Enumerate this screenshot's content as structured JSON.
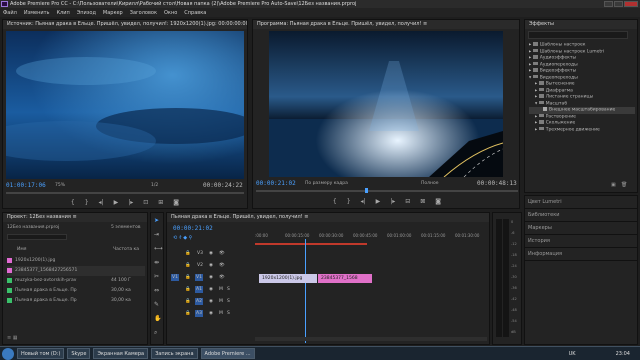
{
  "window": {
    "title": "Adobe Premiere Pro CC - C:\\Пользователи\\Кирилл\\Рабочий стол\\Новая папка (2)\\Adobe Premiere Pro Auto-Save\\12Без названия.prproj"
  },
  "menu": [
    "Файл",
    "Изменить",
    "Клип",
    "Эпизод",
    "Маркер",
    "Заголовок",
    "Окно",
    "Справка"
  ],
  "source": {
    "title": "Источник: Пьяная драка в Ельце. Пришёл, увидел, получил!: 1920x1200(1).jpg: 00:00:00:00",
    "timecode": "01:00:17:06",
    "zoom": "75%",
    "page": "1/2",
    "duration": "00:00:24:22"
  },
  "program": {
    "title": "Программа: Пьяная драка в Ельце. Пришёл, увидел, получил! ≡",
    "timecode": "00:00:21:02",
    "fit": "По размеру кадра",
    "quality": "Полное",
    "duration": "00:00:48:13"
  },
  "effects": {
    "title": "Эффекты",
    "items": [
      "Шаблоны настроек",
      "Шаблоны настроек Lumetri",
      "Аудиоэффекты",
      "Аудиопереходы",
      "Видеоэффекты",
      "Видеопереходы",
      "Вытеснение",
      "Диафрагма",
      "Листание страницы",
      "Масштаб",
      "Внешнее масштабирование",
      "Растворение",
      "Скольжение",
      "Трехмерное движение"
    ],
    "side": [
      "Цвет Lumetri",
      "Библиотеки",
      "Маркеры",
      "История",
      "Информация"
    ]
  },
  "project": {
    "title": "Проект: 12Без названия ≡",
    "file": "12Без названия.prproj",
    "count": "5 элементов",
    "col_name": "Имя",
    "col_rate": "Частота ка",
    "items": [
      {
        "name": "1920x1200(1).jpg",
        "rate": "",
        "color": "#e06ad2"
      },
      {
        "name": "23845377_1568427256571",
        "rate": "",
        "color": "#e06ad2"
      },
      {
        "name": "muzyka-bez-avtorskih-prav",
        "rate": "44 100 Г",
        "color": "#3ac06a"
      },
      {
        "name": "Пьяная драка в Ельце. Пр",
        "rate": "30,00 ка",
        "color": "#3ac06a"
      },
      {
        "name": "Пьяная драка в Ельце. Пр",
        "rate": "30,00 ка",
        "color": "#3ac06a"
      }
    ]
  },
  "timeline": {
    "title": "Пьяная драка в Ельце. Пришёл, увидел, получил! ≡",
    "timecode": "00:00:21:02",
    "ruler": [
      ":00:00",
      "00:00:15:00",
      "00:00:30:00",
      "00:00:45:00",
      "00:01:00:00",
      "00:01:15:00",
      "00:01:30:00",
      "00:01:45:00"
    ],
    "tracks": [
      "V3",
      "V2",
      "V1",
      "A1",
      "A2",
      "A3"
    ],
    "clip1": "1920x1200(1).jpg",
    "clip2": "23845377_1568",
    "meter": [
      "0",
      "-6",
      "-12",
      "-18",
      "-24",
      "-30",
      "-36",
      "-42",
      "-48",
      "-54",
      "dB"
    ]
  },
  "taskbar": {
    "items": [
      "Новый том (D:)",
      "Skype",
      "Экранная Камера",
      "Запись экрана",
      "Adobe Premiere ..."
    ],
    "lang": "UK",
    "time": "23:04"
  }
}
